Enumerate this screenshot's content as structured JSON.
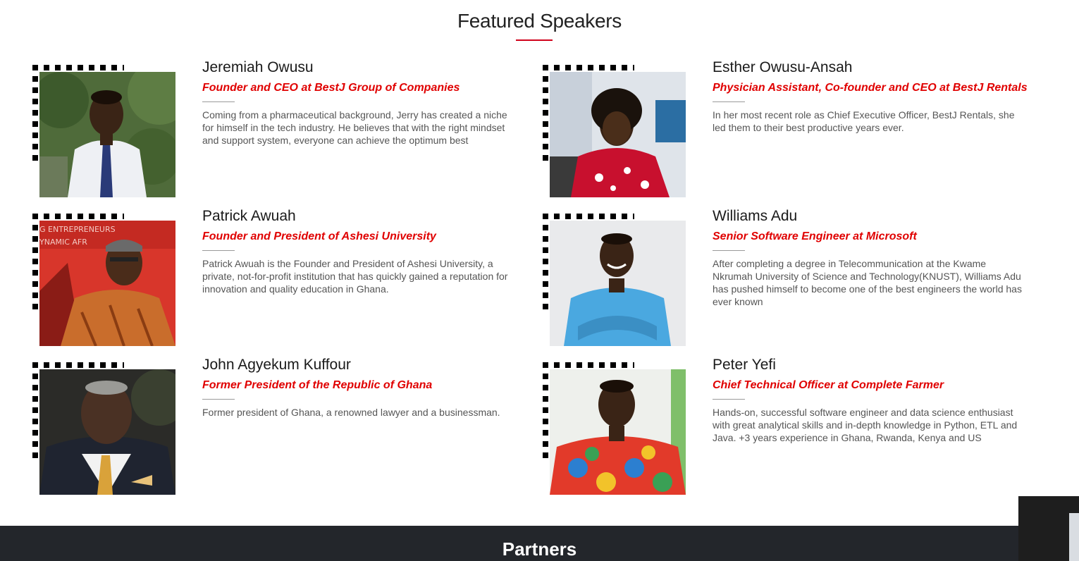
{
  "section": {
    "title": "Featured Speakers"
  },
  "speakers": [
    {
      "name": "Jeremiah Owusu",
      "role": "Founder and CEO at BestJ Group of Companies",
      "bio": "Coming from a pharmaceutical background, Jerry has created a niche for himself in the tech industry. He believes that with the right mindset and support system, everyone can achieve the optimum best"
    },
    {
      "name": "Esther Owusu-Ansah",
      "role": "Physician Assistant, Co-founder and CEO at BestJ Rentals",
      "bio": "In her most recent role as Chief Executive Officer, BestJ Rentals, she led them to their best productive years ever."
    },
    {
      "name": "Patrick Awuah",
      "role": "Founder and President of Ashesi University",
      "bio": "Patrick Awuah is the Founder and President of Ashesi University, a private, not-for-profit institution that has quickly gained a reputation for innovation and quality education in Ghana."
    },
    {
      "name": "Williams Adu",
      "role": "Senior Software Engineer at Microsoft",
      "bio": "After completing a degree in Telecommunication at the Kwame Nkrumah University of Science and Technology(KNUST), Williams Adu has pushed himself to become one of the best engineers the world has ever known"
    },
    {
      "name": "John Agyekum Kuffour",
      "role": "Former President of the Republic of Ghana",
      "bio": "Former president of Ghana, a renowned lawyer and a businessman."
    },
    {
      "name": "Peter Yefi",
      "role": "Chief Technical Officer at Complete Farmer",
      "bio": "Hands-on, successful software engineer and data science enthusiast with great analytical skills and in-depth knowledge in Python, ETL and Java. +3 years experience in Ghana, Rwanda, Kenya and US"
    }
  ],
  "photo_banner_text": {
    "line1": "G ENTREPRENEURS",
    "line2": "YNAMIC AFR"
  },
  "partners": {
    "title": "Partners"
  },
  "colors": {
    "accent": "#e00000",
    "footer_bg": "#23262b"
  }
}
